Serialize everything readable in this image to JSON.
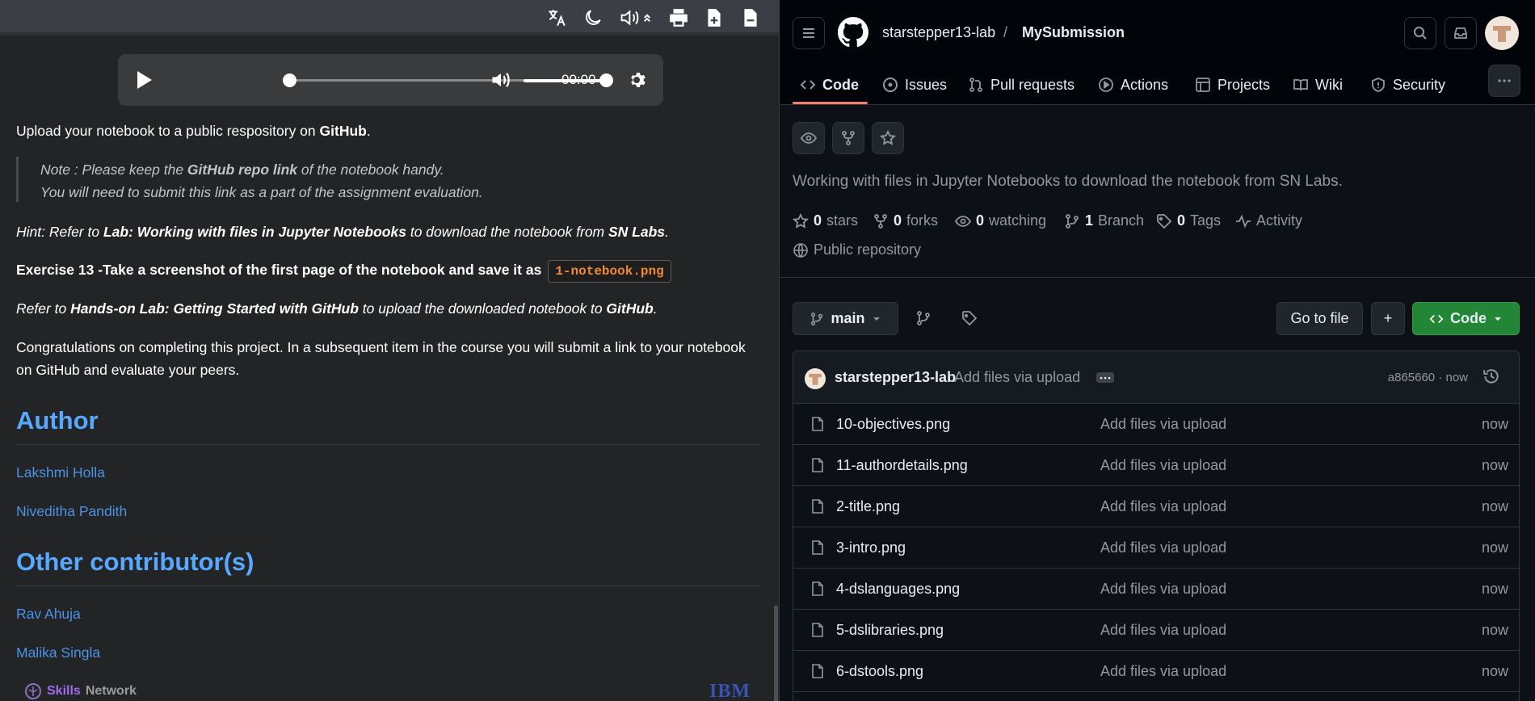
{
  "left": {
    "player": {
      "time": "00:00"
    },
    "intro": {
      "prefix": "Upload your notebook to a public respository on ",
      "bold": "GitHub",
      "suffix": "."
    },
    "note": {
      "line1_a": "Note : Please keep the ",
      "line1_b": "GitHub repo link",
      "line1_c": " of the notebook handy.",
      "line2": "You will need to submit this link as a part of the assignment evaluation."
    },
    "hint": {
      "a": "Hint: Refer to ",
      "b": "Lab: Working with files in Jupyter Notebooks",
      "c": " to download the notebook from ",
      "d": "SN Labs",
      "e": "."
    },
    "exercise": {
      "text": "Exercise 13 -Take a screenshot of the first page of the notebook and save it as",
      "code": "1-notebook.png"
    },
    "refer": {
      "a": "Refer to ",
      "b": "Hands-on Lab: Getting Started with GitHub",
      "c": " to upload the downloaded notebook to ",
      "d": "GitHub",
      "e": "."
    },
    "congrats": {
      "line1": "Congratulations on completing this project. In a subsequent item in the course you will submit a link to your notebook",
      "line2": "on GitHub and evaluate your peers."
    },
    "author_heading": "Author",
    "authors": [
      "Lakshmi Holla",
      "Niveditha Pandith"
    ],
    "contrib_heading": "Other contributor(s)",
    "contributors": [
      "Rav Ahuja",
      "Malika Singla"
    ],
    "footer": {
      "skills": "Skills",
      "network": "Network",
      "ibm": "IBM"
    }
  },
  "github": {
    "owner": "starstepper13-lab",
    "slash": "/",
    "repo": "MySubmission",
    "tabs": [
      "Code",
      "Issues",
      "Pull requests",
      "Actions",
      "Projects",
      "Wiki",
      "Security"
    ],
    "description": "Working with files in Jupyter Notebooks to download the notebook from SN Labs.",
    "stats": {
      "stars_n": "0",
      "stars_l": "stars",
      "forks_n": "0",
      "forks_l": "forks",
      "watching_n": "0",
      "watching_l": "watching",
      "branch_n": "1",
      "branch_l": "Branch",
      "tags_n": "0",
      "tags_l": "Tags",
      "activity": "Activity",
      "visibility": "Public repository"
    },
    "branch": "main",
    "go_to_file": "Go to file",
    "add": "+",
    "code_btn": "Code",
    "commit": {
      "author": "starstepper13-lab",
      "message": "Add files via upload",
      "hash_time": "a865660 · now"
    },
    "files": [
      {
        "name": "10-objectives.png",
        "msg": "Add files via upload",
        "date": "now"
      },
      {
        "name": "11-authordetails.png",
        "msg": "Add files via upload",
        "date": "now"
      },
      {
        "name": "2-title.png",
        "msg": "Add files via upload",
        "date": "now"
      },
      {
        "name": "3-intro.png",
        "msg": "Add files via upload",
        "date": "now"
      },
      {
        "name": "4-dslanguages.png",
        "msg": "Add files via upload",
        "date": "now"
      },
      {
        "name": "5-dslibraries.png",
        "msg": "Add files via upload",
        "date": "now"
      },
      {
        "name": "6-dstools.png",
        "msg": "Add files via upload",
        "date": "now"
      }
    ],
    "colors": {
      "accent_tab": "#f78166",
      "code_button": "#238636"
    }
  }
}
